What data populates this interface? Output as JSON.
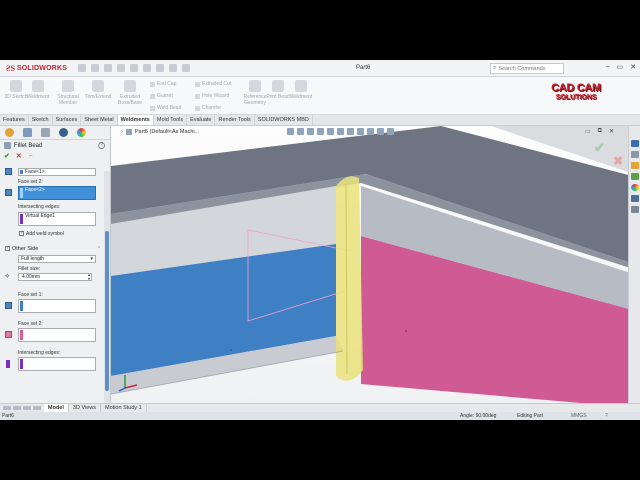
{
  "titlebar": {
    "app_name": "SOLIDWORKS",
    "document": "Part6",
    "search_placeholder": "Search Commands"
  },
  "ribbon": {
    "large_buttons": [
      "3D Sketch",
      "Weldment",
      "Structural Member",
      "Trim/Extend",
      "Extruded Boss/Base",
      "Extruded Cut"
    ],
    "small_buttons": [
      "End Cap",
      "Gusset",
      "Weld Bead",
      "Extruded Cut",
      "Hole Wizard",
      "Chamfer"
    ],
    "right_buttons": [
      "Reference Geometry",
      "Print Bead",
      "Weldment"
    ],
    "brand_line1": "CAD CAM",
    "brand_line2": "SOLUTIONS"
  },
  "tabs": [
    "Features",
    "Sketch",
    "Surfaces",
    "Sheet Metal",
    "Weldments",
    "Mold Tools",
    "Evaluate",
    "Render Tools",
    "SOLIDWORKS MBD"
  ],
  "active_tab": "Weldments",
  "property_manager": {
    "title": "Fillet Bead",
    "first_side": {
      "face_set1_value": "Face<1>",
      "face_set2_label": "Face set 2:",
      "face_set2_value": "Face<2>",
      "edges_label": "Intersecting edges:",
      "edges_value": "Virtual Edge1",
      "weld_symbol_label": "Add weld symbol",
      "weld_symbol_checked": true
    },
    "other_side": {
      "header": "Other Side",
      "checked": true,
      "type": "Full length",
      "fillet_size_label": "Fillet size:",
      "fillet_size_value": "4.00mm",
      "face_set1_label": "Face set 1:",
      "face_set2_label": "Face set 2:",
      "edges_label": "Intersecting edges:"
    }
  },
  "viewport": {
    "breadcrumb": "Part6 (Default<As Machi..."
  },
  "model_tabs": [
    "Model",
    "3D Views",
    "Motion Study 1"
  ],
  "active_model_tab": "Model",
  "status": {
    "left": "Part6",
    "angle": "Angle: 90.00deg",
    "mode": "Editing Part",
    "units": "MMGS"
  },
  "colors": {
    "brand_red": "#c8202a",
    "face_blue": "#3f7fc4",
    "face_pink": "#e05a98",
    "bead_yellow": "#e9e27a",
    "edge_purple": "#7a2fb8"
  }
}
